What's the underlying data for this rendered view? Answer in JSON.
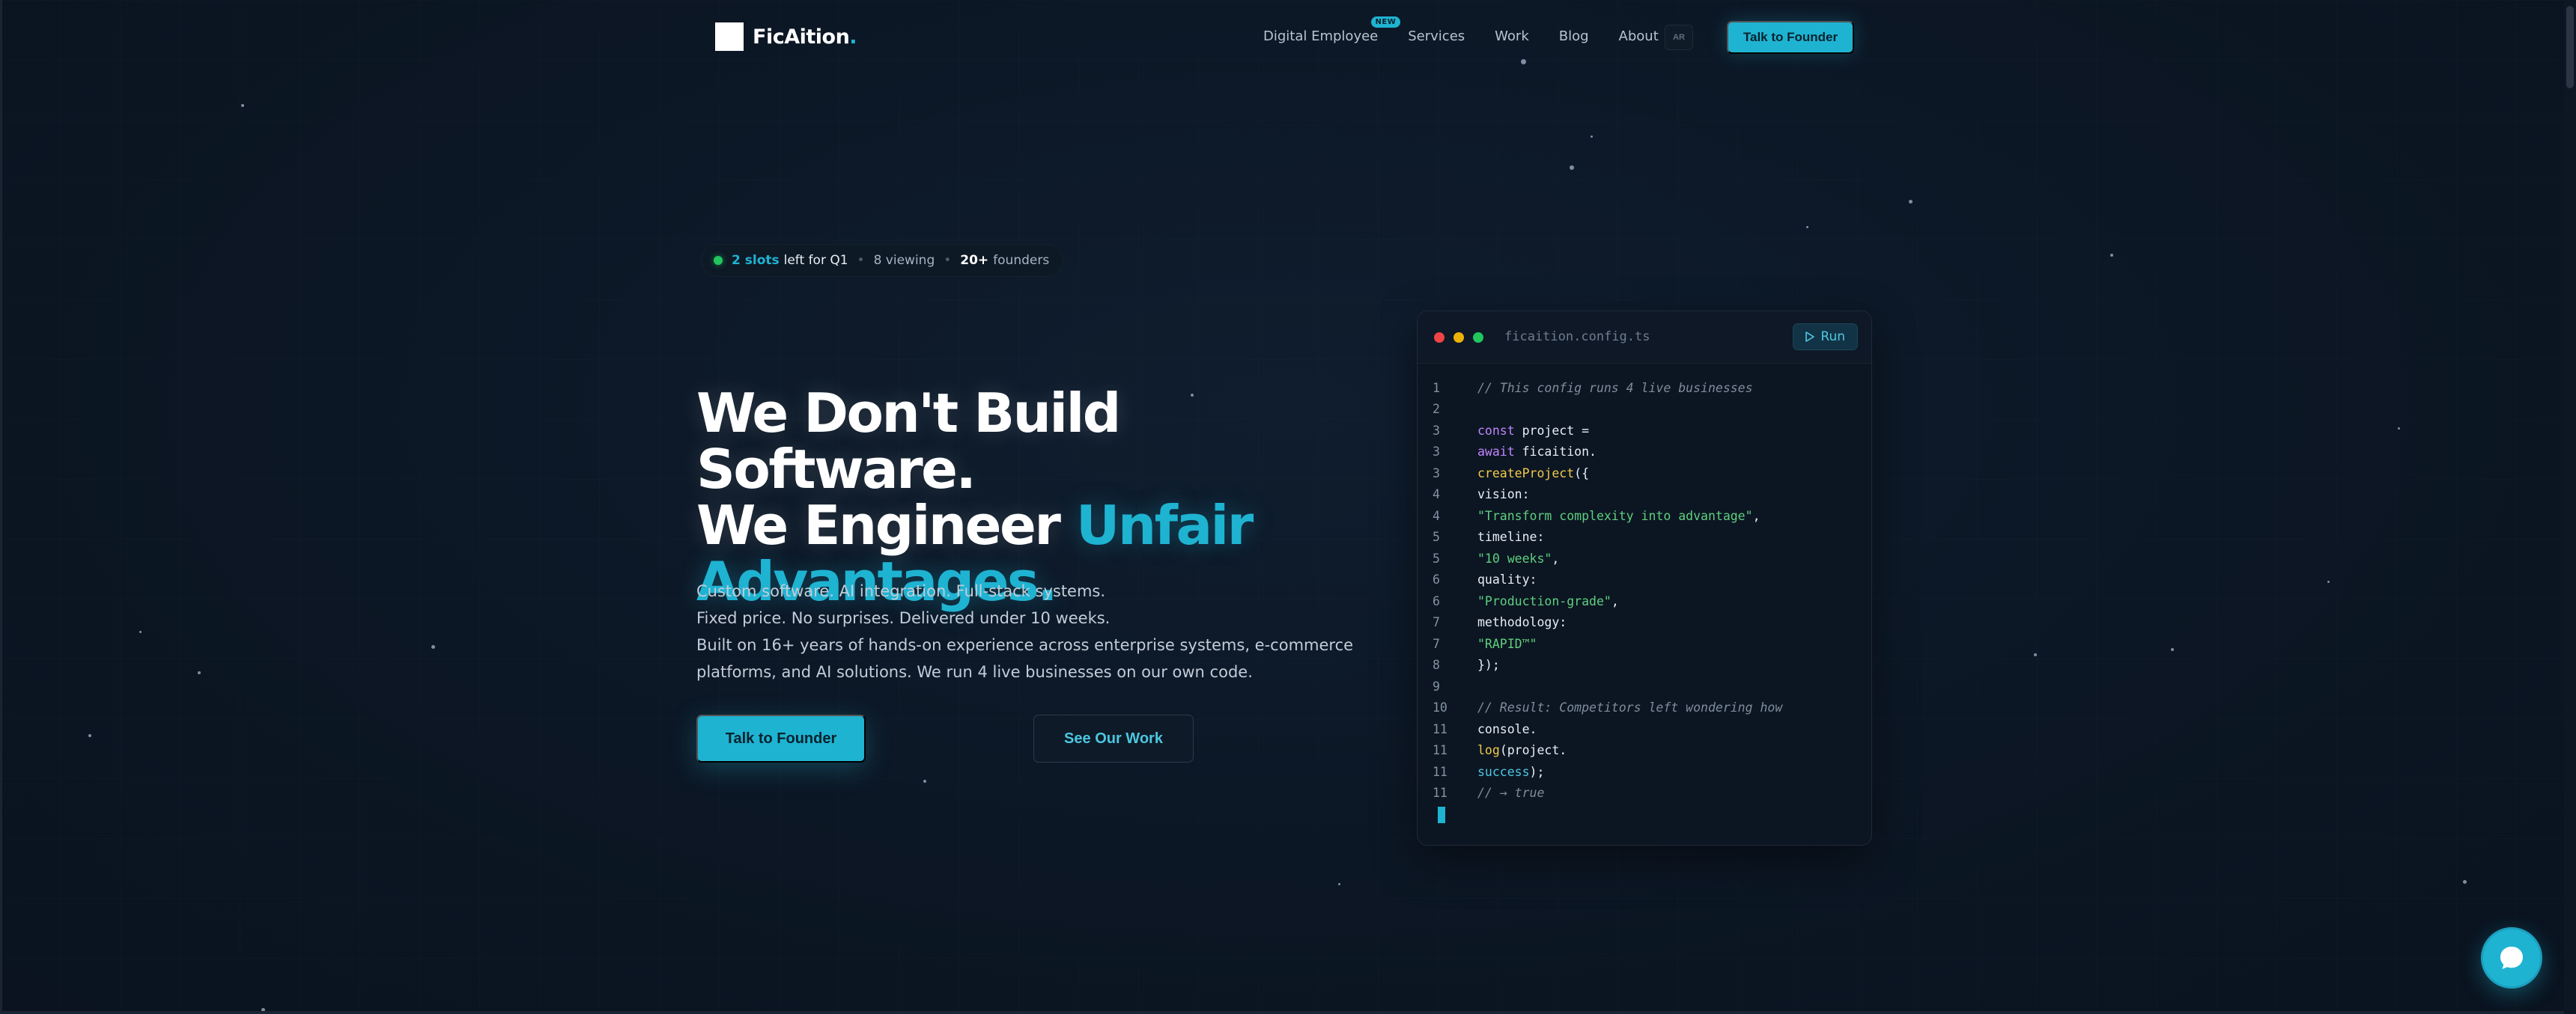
{
  "nav": {
    "logo_text": "FicAition",
    "logo_dot": ".",
    "links": [
      {
        "label": "Digital Employee",
        "badge": "NEW"
      },
      {
        "label": "Services"
      },
      {
        "label": "Work"
      },
      {
        "label": "Blog"
      },
      {
        "label": "About"
      }
    ],
    "lang": "AR",
    "cta": "Talk to Founder"
  },
  "badge": {
    "slots": "2 slots",
    "slots_suffix": "left for Q1",
    "viewing": "8 viewing",
    "founders_count": "20+",
    "founders_label": "founders"
  },
  "hero": {
    "line1": "We Don't Build Software.",
    "line2_pre": "We Engineer ",
    "line2_accent": "Unfair",
    "line3_accent": "Advantages.",
    "sub": [
      "Custom software. AI integration. Full-stack systems.",
      "Fixed price. No surprises. Delivered under 10 weeks.",
      "Built on 16+ years of hands-on experience across enterprise systems, e-commerce",
      "platforms, and AI solutions. We run 4 live businesses on our own code."
    ],
    "primary_cta": "Talk to Founder",
    "secondary_cta": "See Our Work"
  },
  "code": {
    "filename": "ficaition.config.ts",
    "run_label": "Run",
    "lines": [
      {
        "n": "1",
        "tokens": [
          {
            "t": "// This config runs 4 live businesses",
            "c": "c-comment"
          }
        ]
      },
      {
        "n": "2",
        "tokens": []
      },
      {
        "n": "3",
        "tokens": [
          {
            "t": "const",
            "c": "c-kw"
          },
          {
            "t": " project =",
            "c": "c-plain"
          }
        ]
      },
      {
        "n": "3",
        "tokens": [
          {
            "t": "await",
            "c": "c-kw"
          },
          {
            "t": " ficaition.",
            "c": "c-plain"
          }
        ]
      },
      {
        "n": "3",
        "tokens": [
          {
            "t": "createProject",
            "c": "c-fn"
          },
          {
            "t": "({",
            "c": "c-plain"
          }
        ]
      },
      {
        "n": "4",
        "tokens": [
          {
            "t": "vision:",
            "c": "c-prop"
          }
        ]
      },
      {
        "n": "4",
        "tokens": [
          {
            "t": "\"Transform complexity into advantage\"",
            "c": "c-str"
          },
          {
            "t": ",",
            "c": "c-plain"
          }
        ]
      },
      {
        "n": "5",
        "tokens": [
          {
            "t": "timeline:",
            "c": "c-prop"
          }
        ]
      },
      {
        "n": "5",
        "tokens": [
          {
            "t": "\"10 weeks\"",
            "c": "c-str"
          },
          {
            "t": ",",
            "c": "c-plain"
          }
        ]
      },
      {
        "n": "6",
        "tokens": [
          {
            "t": "quality:",
            "c": "c-prop"
          }
        ]
      },
      {
        "n": "6",
        "tokens": [
          {
            "t": "\"Production-grade\"",
            "c": "c-str"
          },
          {
            "t": ",",
            "c": "c-plain"
          }
        ]
      },
      {
        "n": "7",
        "tokens": [
          {
            "t": "methodology:",
            "c": "c-prop"
          }
        ]
      },
      {
        "n": "7",
        "tokens": [
          {
            "t": "\"RAPID™\"",
            "c": "c-str"
          }
        ]
      },
      {
        "n": "8",
        "tokens": [
          {
            "t": "});",
            "c": "c-plain"
          }
        ]
      },
      {
        "n": "9",
        "tokens": []
      },
      {
        "n": "10",
        "tokens": [
          {
            "t": "// Result: Competitors left wondering how",
            "c": "c-comment"
          }
        ]
      },
      {
        "n": "11",
        "tokens": [
          {
            "t": "console.",
            "c": "c-plain"
          }
        ]
      },
      {
        "n": "11",
        "tokens": [
          {
            "t": "log",
            "c": "c-fn"
          },
          {
            "t": "(project.",
            "c": "c-plain"
          }
        ]
      },
      {
        "n": "11",
        "tokens": [
          {
            "t": "success",
            "c": "c-cyan"
          },
          {
            "t": ");",
            "c": "c-plain"
          }
        ]
      },
      {
        "n": "11",
        "tokens": [
          {
            "t": "// → true",
            "c": "c-comment"
          }
        ]
      }
    ]
  },
  "chat": {
    "icon": "chat-bubble-icon"
  },
  "colors": {
    "accent": "#1fb3d2",
    "background": "#0c1624",
    "live": "#22c55e"
  }
}
